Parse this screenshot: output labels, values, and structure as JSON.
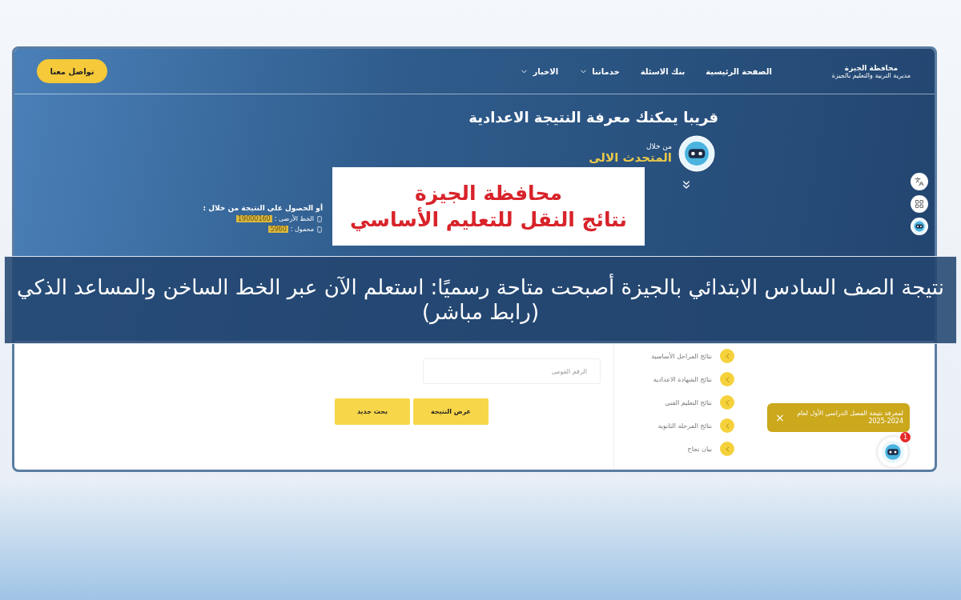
{
  "nav": {
    "logo_title": "محافظة الجيزة",
    "logo_subtitle": "مديرية التربية والتعليم بالجيزة",
    "items": [
      {
        "label": "الصفحة الرئيسية",
        "dropdown": false
      },
      {
        "label": "بنك الاسئلة",
        "dropdown": false
      },
      {
        "label": "خدماتنا",
        "dropdown": true
      },
      {
        "label": "الاخبار",
        "dropdown": true
      }
    ],
    "contact_button": "تواصل معنا"
  },
  "hero": {
    "headline": "قريبا يمكنك معرفة **النتيجة الاعدادية**",
    "via": "من خلال",
    "assistant": "المتحدث الالى"
  },
  "notice_image": {
    "lines": [
      "محافظة الجيزة",
      "نتائج النقل للتعليم الأساسي"
    ]
  },
  "contact_info": {
    "title": "أو الحصول على النتيجة من خلال :",
    "lines": [
      {
        "label": "الخط الأرضى :",
        "number": "19000160"
      },
      {
        "label": "محمول :",
        "number": "5960"
      }
    ]
  },
  "search": {
    "placeholder": "الرقم القومى",
    "buttons": [
      "عرض النتيجة",
      "بحث جديد"
    ]
  },
  "results_menu": [
    "نتائج المراحل الأساسية",
    "نتائج الشهادة الاعدادية",
    "نتائج التعليم الفني",
    "نتائج المرحلة الثانوية",
    "بيان نجاح"
  ],
  "toast": {
    "text": "لمعرفة نتيجة الفصل الدراسي الأول لعام 2024-2025",
    "close": "×"
  },
  "chat": {
    "badge": "1"
  },
  "headline_banner": "نتيجة الصف السادس الابتدائي بالجيزة أصبحت متاحة رسميًا: استعلم الآن عبر الخط الساخن والمساعد الذكي (رابط مباشر)"
}
